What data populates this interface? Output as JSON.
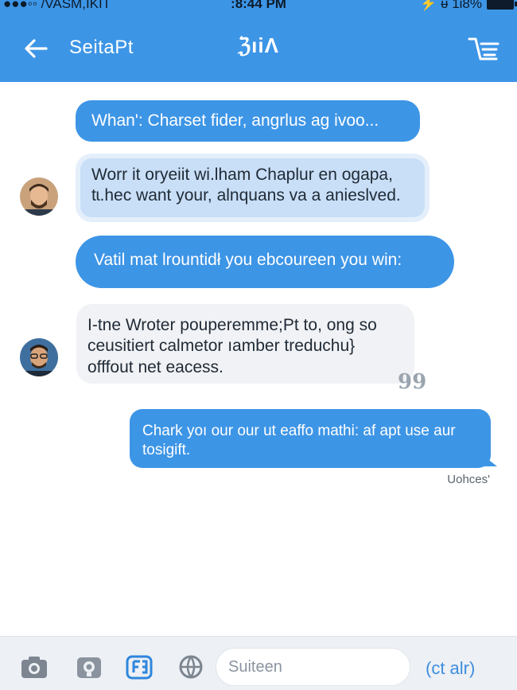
{
  "status_bar": {
    "carrier": "●●●◦◦ /VASM,IKIT",
    "time": ":8:44 PM",
    "battery_text": "⚡ ᵾ 1i8%"
  },
  "nav": {
    "back_label": "SeitaPt",
    "center_label": "ℨıiΛ",
    "menu_icon": "list-icon"
  },
  "messages": [
    {
      "type": "sent",
      "text": "Whan': Charset fider, angrlus ag ivoo..."
    },
    {
      "type": "received",
      "lines": [
        "Worr it oryeiit wi.lham Chaplur en ogapa,",
        "tɩ.hec want your, alnquans va a anieslved."
      ]
    },
    {
      "type": "sent",
      "text": "Vatil mat lrountidł you ebcoureen you win:"
    },
    {
      "type": "received",
      "lines": [
        "I-tne Wroter pouperemme;Pt to, ong so",
        "ceusitiert calmetor ıamber treduchu}",
        "offfout net eacess."
      ]
    },
    {
      "type": "sent",
      "lines": [
        "Chark yoı our our ut eaffo mathi: af apt use aur",
        "tosigift."
      ]
    }
  ],
  "quote_mark": "99",
  "timestamp": "Uohces'",
  "input_bar": {
    "placeholder": "Suiteen",
    "action_label": "(ct alr)",
    "icons": [
      "camera-icon",
      "photo-icon",
      "app-icon",
      "globe-icon"
    ]
  },
  "colors": {
    "accent": "#3d95e6",
    "received_light": "#e4effb",
    "received_gray": "#f1f2f5"
  }
}
